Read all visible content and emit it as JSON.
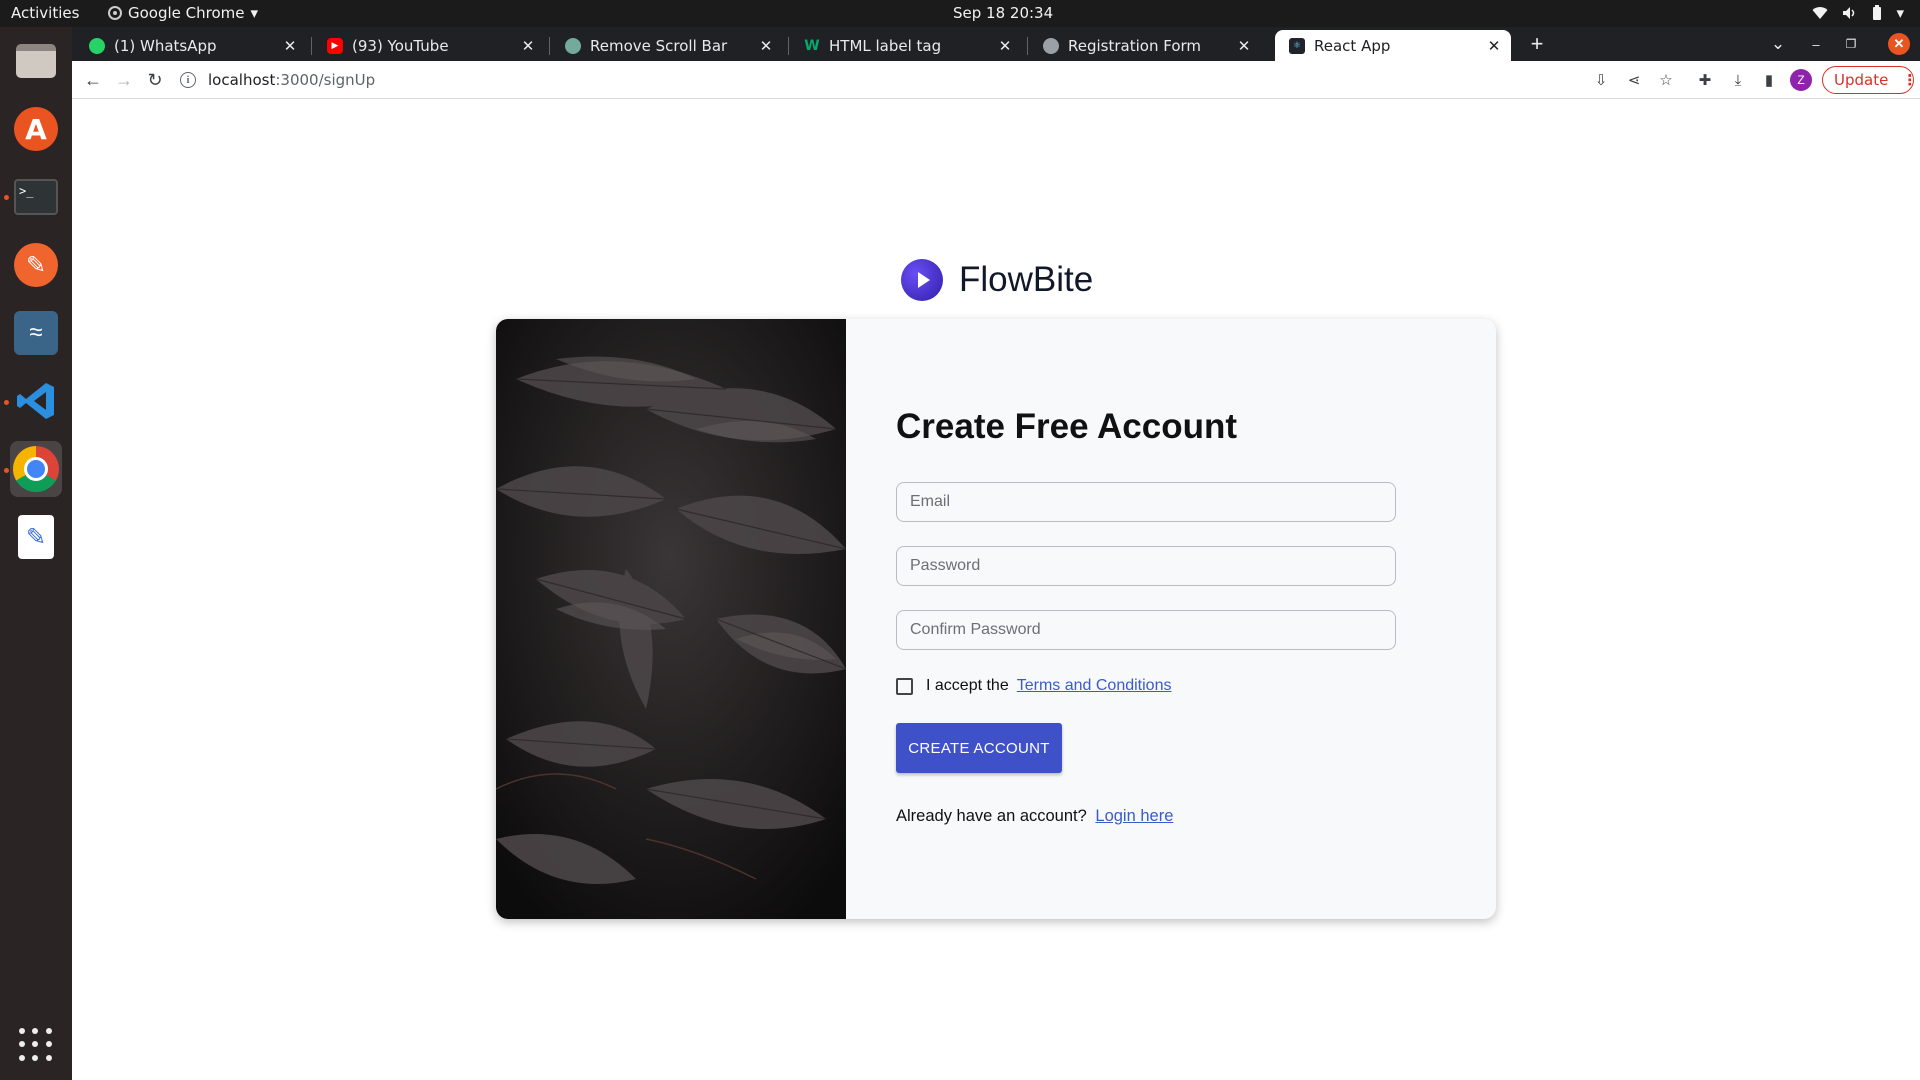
{
  "system": {
    "activities": "Activities",
    "app_name": "Google Chrome",
    "clock": "Sep 18  20:34"
  },
  "browser": {
    "tabs": [
      {
        "label": "(1) WhatsApp",
        "favicon": "whatsapp-icon",
        "color": "#25d366"
      },
      {
        "label": "(93) YouTube",
        "favicon": "youtube-icon",
        "color": "#ff0000"
      },
      {
        "label": "Remove Scroll Bar",
        "favicon": "chatgpt-icon",
        "color": "#74aa9c"
      },
      {
        "label": "HTML label tag",
        "favicon": "w3schools-icon",
        "color": "#04aa6d"
      },
      {
        "label": "Registration Form",
        "favicon": "globe-icon",
        "color": "#9aa0a6"
      },
      {
        "label": "React App",
        "favicon": "react-icon",
        "color": "#61dafb"
      }
    ],
    "address": {
      "host": "localhost",
      "path": ":3000/signUp"
    },
    "profile_initial": "Z",
    "update_label": "Update"
  },
  "page": {
    "brand_name": "FlowBite",
    "title": "Create Free Account",
    "email_placeholder": "Email",
    "password_placeholder": "Password",
    "confirm_placeholder": "Confirm Password",
    "terms_prefix": "I accept the",
    "terms_link": "Terms and Conditions",
    "create_button": "CREATE ACCOUNT",
    "login_prefix": "Already have an account?",
    "login_link": "Login here"
  },
  "colors": {
    "accent": "#3f51c8",
    "link": "#3b5bcc",
    "update": "#d93025"
  }
}
